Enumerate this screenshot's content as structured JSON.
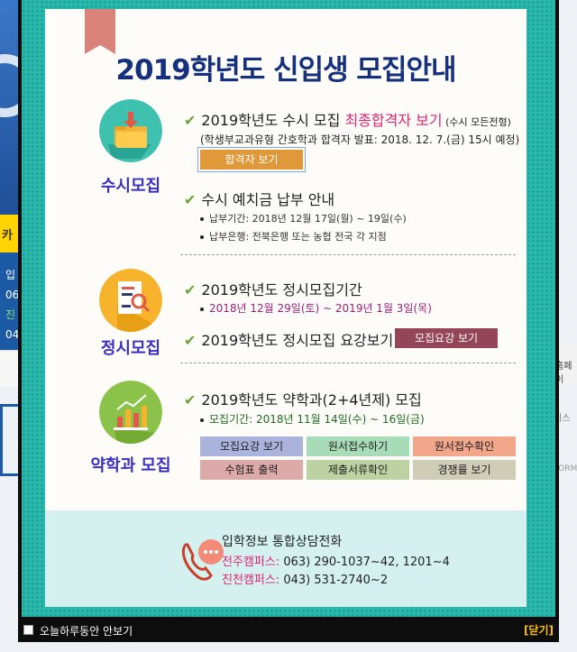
{
  "background": {
    "left_text_1": "카",
    "left_text_2a": "입",
    "left_text_2b": "06",
    "left_text_2c": "진",
    "left_text_2d": "04",
    "right_text_1": "홈페이",
    "right_text_2": "비스",
    "right_text_3": "FORM"
  },
  "popup": {
    "title": "2019학년도 신입생 모집안내",
    "sections": {
      "susi": {
        "label": "수시모집",
        "line1_prefix": "2019학년도 수시 모집 ",
        "line1_highlight": "최종합격자 보기",
        "line1_suffix": " (수시 모든전형)",
        "line1_note": "(학생부교과유형 간호학과 합격자 발표: 2018. 12. 7.(금) 15시 예정)",
        "button": "합격자 보기",
        "line2": "수시 예치금 납부 안내",
        "bullet1": "납부기간: 2018년 12월 17일(월) ~ 19일(수)",
        "bullet2": "납부은행: 전북은행 또는 농협 전국 각 지점"
      },
      "jeongsi": {
        "label": "정시모집",
        "line1": "2019학년도 정시모집기간",
        "bullet1": "2018년 12월 29일(토) ~ 2019년 1월 3일(목)",
        "line2": "2019학년도 정시모집 요강보기",
        "button": "모집요강 보기"
      },
      "pharmacy": {
        "label": "약학과 모집",
        "line1": "2019학년도 약학과(2+4년제) 모집",
        "bullet1": "모집기간: 2018년 11월 14일(수) ~ 16일(금)",
        "buttons": [
          "모집요강 보기",
          "원서접수하기",
          "원서접수확인",
          "수험표 출력",
          "제출서류확인",
          "경쟁률 보기"
        ]
      }
    },
    "contact": {
      "heading": "입학정보 통합상담전화",
      "campus1_label": "전주캠퍼스:",
      "campus1_phone": " 063) 290-1037~42, 1201~4",
      "campus2_label": "진천캠퍼스:",
      "campus2_phone": " 043) 531-2740~2"
    },
    "footer": {
      "dont_show_today": "오늘하루동안 안보기",
      "close": "[닫기]"
    }
  },
  "colors": {
    "title": "#15307c",
    "highlight": "#e2256f",
    "teal": "#2ab8ac",
    "check": "#6aa73a",
    "orange_button": "#e0993a",
    "maroon_button": "#944558",
    "grid_colors": [
      "#a9b3dc",
      "#a8dcb8",
      "#f2a68a",
      "#dcaaa8",
      "#bcd2a2",
      "#cfcdb8"
    ]
  }
}
